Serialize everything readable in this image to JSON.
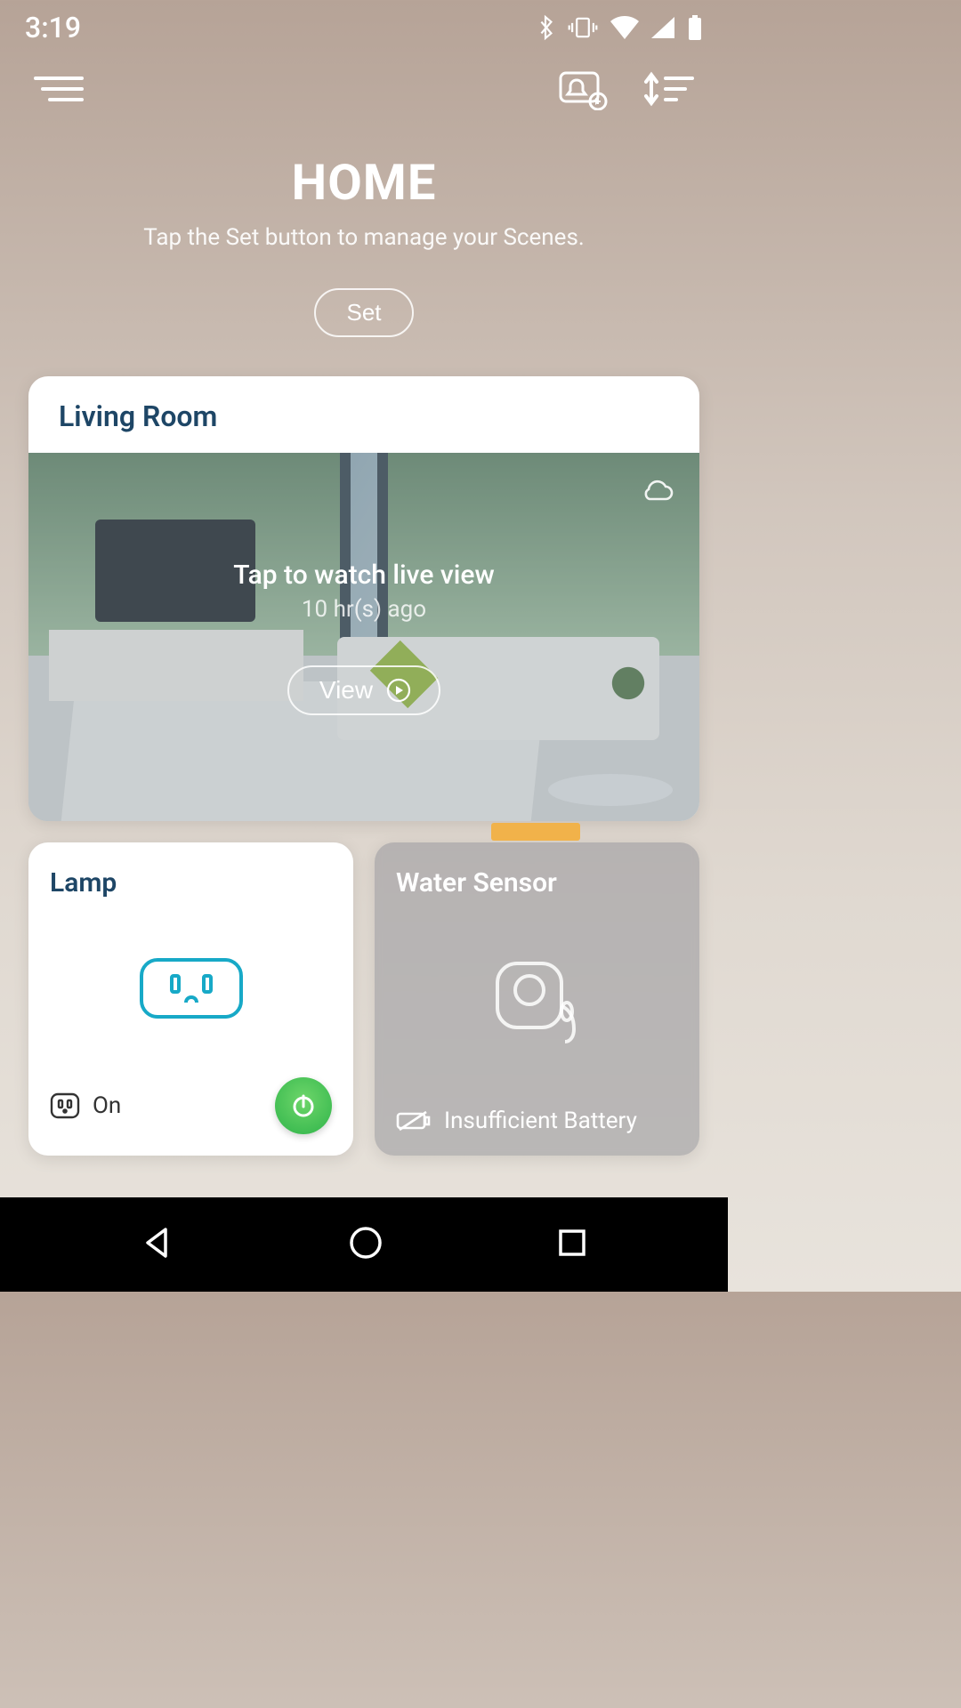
{
  "status": {
    "time": "3:19"
  },
  "header": {
    "title": "HOME",
    "subtitle": "Tap the Set button to manage your Scenes.",
    "set_label": "Set"
  },
  "room_card": {
    "name": "Living Room",
    "live_label": "Tap to watch live view",
    "live_time": "10 hr(s) ago",
    "view_label": "View"
  },
  "devices": [
    {
      "name": "Lamp",
      "status_label": "On",
      "type": "smart-plug",
      "power_on": true
    },
    {
      "name": "Water Sensor",
      "status_label": "Insufficient Battery",
      "type": "water-sensor"
    }
  ],
  "icons": {
    "menu": "menu-icon",
    "automation": "automation-bell-icon",
    "sort": "sort-icon",
    "cloud": "cloud-icon",
    "play": "play-circle-icon",
    "plug": "plug-outlet-icon",
    "plug_small": "plug-outlet-small-icon",
    "power": "power-icon",
    "water_sensor": "water-sensor-icon",
    "battery_low": "battery-low-icon"
  },
  "colors": {
    "primary_text": "#1e4666",
    "power_green": "#3cc24e"
  }
}
